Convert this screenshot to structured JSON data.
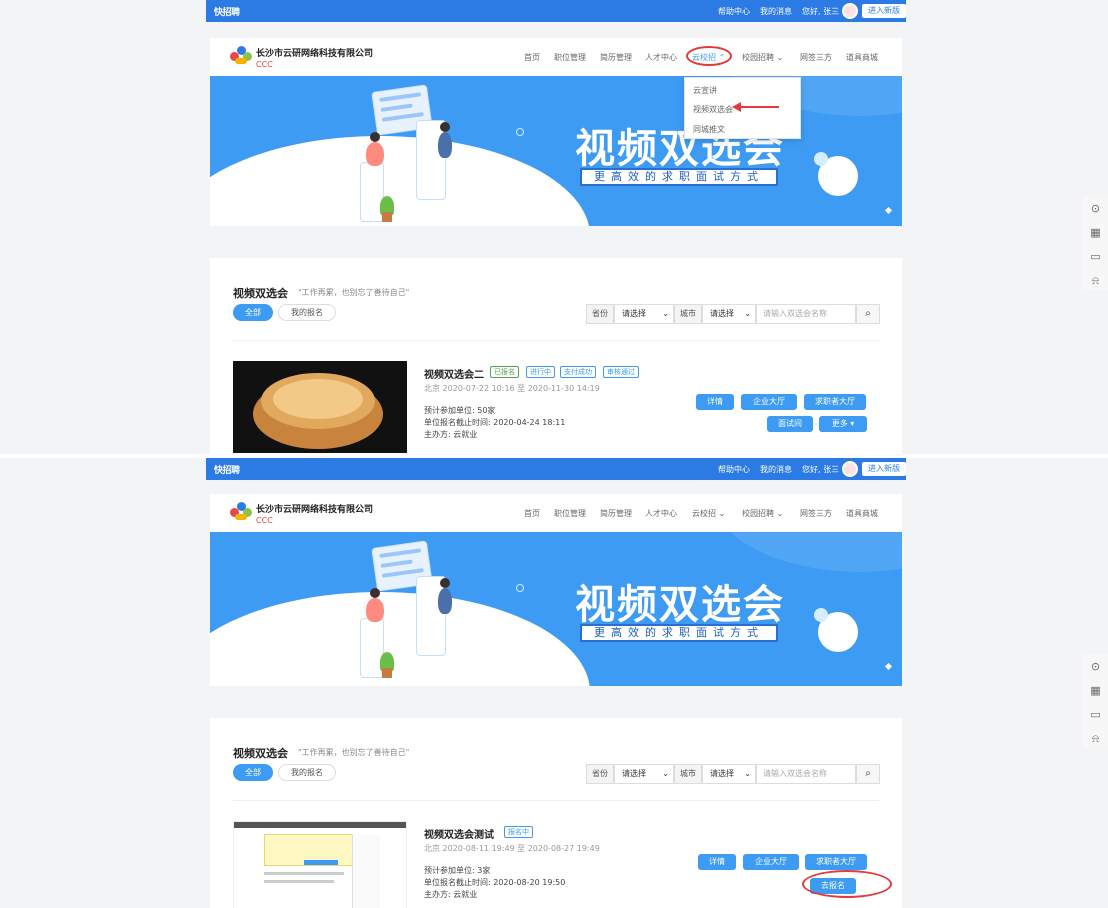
{
  "topbar": {
    "brand": "快招聘",
    "links": [
      "帮助中心",
      "我的消息",
      "您好, 张三"
    ],
    "new_version": "进入新版"
  },
  "header": {
    "company": "长沙市云研网络科技有限公司",
    "sub": "CCC",
    "nav": [
      "首页",
      "职位管理",
      "简历管理",
      "人才中心",
      "云校招 ⌃",
      "校园招聘 ⌄",
      "网签三方",
      "道具商城"
    ],
    "nav2": [
      "首页",
      "职位管理",
      "简历管理",
      "人才中心",
      "云校招 ⌄",
      "校园招聘 ⌄",
      "网签三方",
      "道具商城"
    ]
  },
  "dropdown": [
    "云宣讲",
    "视频双选会",
    "同城推文"
  ],
  "banner": {
    "title": "视频双选会",
    "subtitle": "更高效的求职面试方式"
  },
  "section": {
    "title": "视频双选会",
    "quote": "\"工作再累，也别忘了善待自己\"",
    "tab_all": "全部",
    "tab_mine": "我的报名",
    "province_label": "省份",
    "province_value": "请选择",
    "city_label": "城市",
    "city_value": "请选择",
    "search_placeholder": "请输入双选会名称"
  },
  "item1": {
    "title": "视频双选会二",
    "tags": [
      "已报名",
      "进行中",
      "支付成功",
      "审核通过"
    ],
    "location_time": "北京    2020-07-22 10:16 至 2020-11-30 14:19",
    "units": "预计参加单位:  50家",
    "deadline": "单位报名截止时间:  2020-04-24 18:11",
    "host": "主办方:  云就业",
    "buttons": [
      "详情",
      "企业大厅",
      "求职者大厅",
      "面试间",
      "更多 ▾"
    ]
  },
  "item2": {
    "title": "视频双选会测试",
    "tags": [
      "报名中"
    ],
    "location_time": "北京    2020-08-11 19:49 至 2020-08-27 19:49",
    "units": "预计参加单位:  3家",
    "deadline": "单位报名截止时间:  2020-08-20 19:50",
    "host": "主办方:  云就业",
    "buttons": [
      "详情",
      "企业大厅",
      "求职者大厅",
      "去报名"
    ]
  },
  "colors": {
    "primary": "#3d9bf3",
    "topbar": "#2c7be5",
    "annotation": "#e23b3b"
  }
}
